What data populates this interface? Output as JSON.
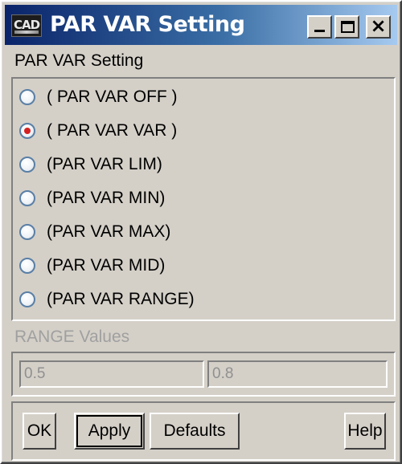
{
  "window": {
    "title": "PAR VAR Setting",
    "icon_name": "cad-app-icon",
    "icon_text": "CAD"
  },
  "titlebar_buttons": [
    {
      "name": "minimize-button",
      "icon": "minimize-icon"
    },
    {
      "name": "maximize-button",
      "icon": "maximize-icon"
    },
    {
      "name": "close-button",
      "icon": "close-icon",
      "glyph": "×"
    }
  ],
  "section": {
    "label": "PAR VAR Setting"
  },
  "options": [
    {
      "label": "( PAR VAR OFF )",
      "checked": false
    },
    {
      "label": "( PAR VAR VAR )",
      "checked": true
    },
    {
      "label": "(PAR VAR LIM)",
      "checked": false
    },
    {
      "label": "(PAR VAR MIN)",
      "checked": false
    },
    {
      "label": "(PAR VAR MAX)",
      "checked": false
    },
    {
      "label": "(PAR VAR MID)",
      "checked": false
    },
    {
      "label": "(PAR VAR RANGE)",
      "checked": false
    }
  ],
  "range": {
    "label": "RANGE Values",
    "min_value": "0.5",
    "max_value": "0.8",
    "enabled": false
  },
  "buttons": {
    "ok": "OK",
    "apply": "Apply",
    "defaults": "Defaults",
    "help": "Help"
  },
  "colors": {
    "titlebar_start": "#0a246a",
    "titlebar_end": "#a6caf0",
    "dialog_bg": "#d4d0c8",
    "radio_selected": "#d42020",
    "disabled_text": "#a0a0a0"
  }
}
